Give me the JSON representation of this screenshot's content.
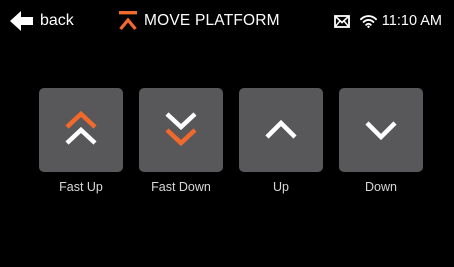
{
  "header": {
    "back_label": "back",
    "title": "MOVE PLATFORM",
    "time": "11:10 AM"
  },
  "icons": {
    "back": "arrow-left-icon",
    "title": "platform-move-icon",
    "mail": "envelope-icon",
    "wifi": "wifi-icon",
    "fast_up": "double-chevron-up-icon",
    "fast_down": "double-chevron-down-icon",
    "up": "chevron-up-icon",
    "down": "chevron-down-icon"
  },
  "colors": {
    "background": "#000000",
    "tile": "#58585a",
    "accent": "#f26a2b",
    "text": "#ffffff",
    "label": "#d8d8d8"
  },
  "controls": [
    {
      "id": "fast_up",
      "label": "Fast Up"
    },
    {
      "id": "fast_down",
      "label": "Fast Down"
    },
    {
      "id": "up",
      "label": "Up"
    },
    {
      "id": "down",
      "label": "Down"
    }
  ]
}
